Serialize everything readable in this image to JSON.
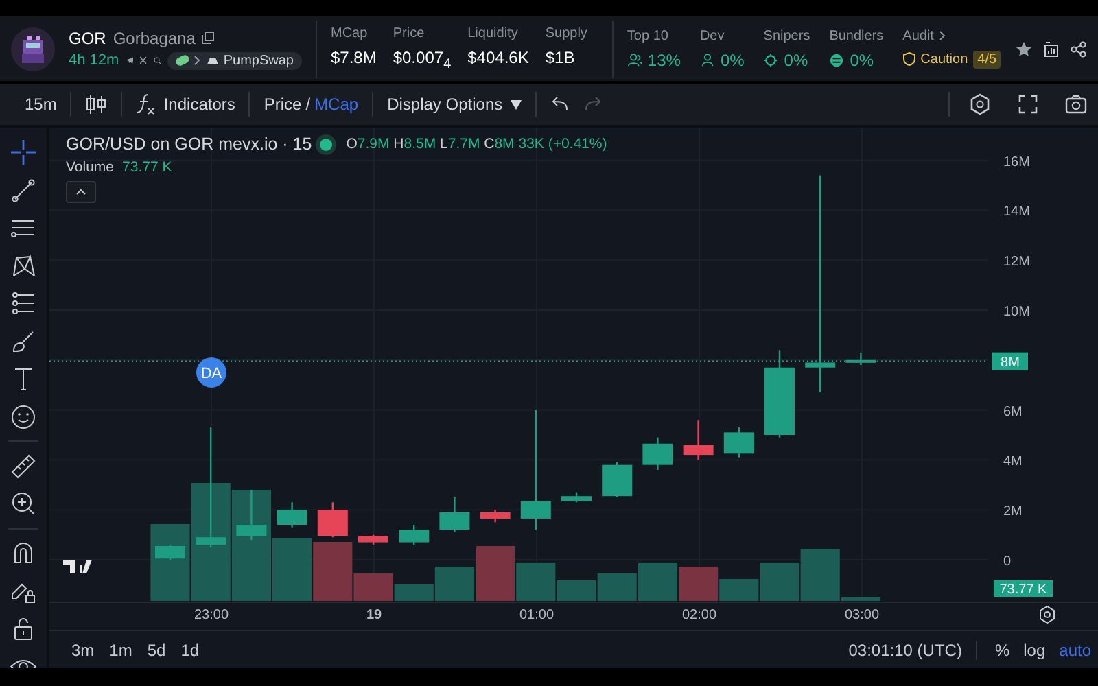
{
  "header": {
    "symbol": "GOR",
    "name": "Gorbagana",
    "age": "4h 12m",
    "dex": "PumpSwap",
    "stats": [
      {
        "label": "MCap",
        "value": "$7.8M"
      },
      {
        "label": "Price",
        "value": "$0.007$_{4}$"
      },
      {
        "label": "Liquidity",
        "value": "$404.6K"
      },
      {
        "label": "Supply",
        "value": "$1B"
      }
    ],
    "holders": [
      {
        "label": "Top 10",
        "value": "13%",
        "kind": "group"
      },
      {
        "label": "Dev",
        "value": "0%",
        "kind": "person"
      },
      {
        "label": "Snipers",
        "value": "0%",
        "kind": "target"
      },
      {
        "label": "Bundlers",
        "value": "0%",
        "kind": "bundle"
      }
    ],
    "audit": {
      "label": "Audit",
      "status": "Caution",
      "score": "4/5"
    }
  },
  "toolbar": {
    "interval": "15m",
    "indicators": "Indicators",
    "units": [
      {
        "label": "Price",
        "selected": false
      },
      {
        "label": "MCap",
        "selected": true
      }
    ],
    "separator": "/",
    "display_options": "Display Options"
  },
  "tools": [
    {
      "kind": "crosshair",
      "selected": true
    },
    {
      "kind": "trendline",
      "selected": false
    },
    {
      "kind": "lines",
      "selected": false
    },
    {
      "kind": "pattern",
      "selected": false
    },
    {
      "kind": "fib",
      "selected": false
    },
    {
      "kind": "brush",
      "selected": false
    },
    {
      "kind": "text",
      "selected": false
    },
    {
      "kind": "emoji",
      "selected": false
    },
    {
      "kind": "ruler",
      "selected": false
    },
    {
      "kind": "zoom",
      "selected": false
    },
    {
      "kind": "magnet",
      "selected": false
    },
    {
      "kind": "lockdraw",
      "selected": false
    },
    {
      "kind": "lock",
      "selected": false
    },
    {
      "kind": "eye",
      "selected": false
    }
  ],
  "legend": {
    "title": "GOR/USD on GOR mevx.io · 15",
    "ohlc": [
      {
        "key": "O",
        "value": "7.9M"
      },
      {
        "key": "H",
        "value": "8.5M"
      },
      {
        "key": "L",
        "value": "7.7M"
      },
      {
        "key": "C",
        "value": "8M"
      }
    ],
    "change": "33K (+0.41%)",
    "volume_label": "Volume",
    "volume_value": "73.77 K"
  },
  "chart": {
    "y_axis": [
      "16M",
      "14M",
      "12M",
      "10M",
      "6M",
      "4M",
      "2M",
      "0"
    ],
    "x_axis": [
      {
        "label": "23:00",
        "kind": "time"
      },
      {
        "label": "19",
        "kind": "day"
      },
      {
        "label": "01:00",
        "kind": "time"
      },
      {
        "label": "02:00",
        "kind": "time"
      },
      {
        "label": "03:00",
        "kind": "time"
      }
    ],
    "price_tag": "8M",
    "marker": "DA",
    "volume_tag": "73.77 K"
  },
  "bottom": {
    "ranges": [
      "3m",
      "1m",
      "5d",
      "1d"
    ],
    "clock": "03:01:10 (UTC)",
    "scales": [
      {
        "label": "%",
        "selected": false
      },
      {
        "label": "log",
        "selected": false
      },
      {
        "label": "auto",
        "selected": true
      }
    ]
  }
}
